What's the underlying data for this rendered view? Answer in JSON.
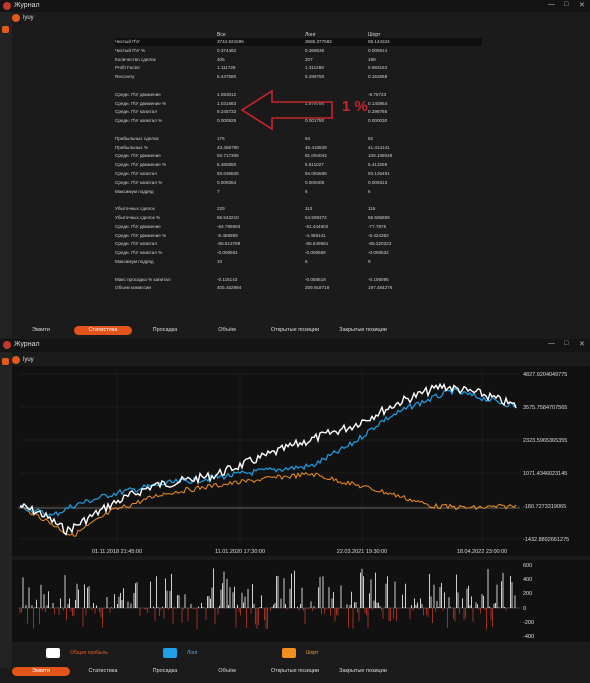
{
  "app": {
    "window_title": "Журнал",
    "close_glyph": "✕",
    "minimize_glyph": "—",
    "maximize_glyph": "□",
    "tab_label": "lyuy"
  },
  "stats": {
    "columns": [
      "Все",
      "Лонг",
      "Шорт"
    ],
    "rows": [
      {
        "label": "Чистый П\\У",
        "values": [
          "3744.521596",
          "3685.377582",
          "59.144324"
        ],
        "highlight": true
      },
      {
        "label": "Чистый П\\У %",
        "values": [
          "0.374482",
          "0.368536",
          "0.005914"
        ]
      },
      {
        "label": "Количество сделок",
        "values": [
          "405",
          "207",
          "198"
        ]
      },
      {
        "label": "Profit Factor",
        "values": [
          "1.111729",
          "1.311289",
          "0.983163"
        ]
      },
      {
        "label": "Recovery",
        "values": [
          "5.447580",
          "5.286760",
          "0.152868"
        ]
      },
      {
        "label": "",
        "values": [
          "",
          "",
          ""
        ]
      },
      {
        "label": "Средн. П\\У движение",
        "values": [
          "4.093012",
          "",
          "-8.76723"
        ]
      },
      {
        "label": "Средн. П\\У движение %",
        "values": [
          "1.031683",
          "1.979794",
          "0.140864"
        ]
      },
      {
        "label": "Средн. П\\У капитал",
        "values": [
          "9.245733",
          "",
          "0.298765"
        ]
      },
      {
        "label": "Средн. П\\У капитал %",
        "values": [
          "0.000925",
          "0.001780",
          "0.000030"
        ]
      },
      {
        "label": "",
        "values": [
          "",
          "",
          ""
        ]
      },
      {
        "label": "Прибыльных сделок",
        "values": [
          "176",
          "94",
          "82"
        ]
      },
      {
        "label": "Прибыльных %",
        "values": [
          "43.456790",
          "45.410628",
          "41.414141"
        ]
      },
      {
        "label": "Средн. П\\У движение",
        "values": [
          "93.717306",
          "81.094043",
          "108.108049"
        ]
      },
      {
        "label": "Средн. П\\У движение %",
        "values": [
          "5.465850",
          "5.511027",
          "5.413259"
        ]
      },
      {
        "label": "Средн. П\\У капитал",
        "values": [
          "93.636826",
          "94.082689",
          "93.125491"
        ]
      },
      {
        "label": "Средн. П\\У капитал %",
        "values": [
          "0.009364",
          "0.009408",
          "0.009313"
        ]
      },
      {
        "label": "Максимум подряд",
        "values": [
          "7",
          "6",
          "6"
        ]
      },
      {
        "label": "",
        "values": [
          "",
          "",
          ""
        ]
      },
      {
        "label": "Убыточных сделок",
        "values": [
          "229",
          "113",
          "116"
        ]
      },
      {
        "label": "Убыточных сделок %",
        "values": [
          "56.543210",
          "54.589372",
          "58.585859"
        ]
      },
      {
        "label": "Средн. П\\У движение",
        "values": [
          "-64.789693",
          "-51.444602",
          "-77.7875"
        ]
      },
      {
        "label": "Средн. П\\У движение %",
        "values": [
          "-5.458959",
          "-4.469141",
          "-6.424362"
        ]
      },
      {
        "label": "Средн. П\\У капитал",
        "values": [
          "-65.613789",
          "-65.649681",
          "-65.320223"
        ]
      },
      {
        "label": "Средн. П\\У капитал %",
        "values": [
          "-0.006561",
          "-0.006568",
          "-0.006532"
        ]
      },
      {
        "label": "Максимум подряд",
        "values": [
          "10",
          "6",
          "9"
        ]
      },
      {
        "label": "",
        "values": [
          "",
          "",
          ""
        ]
      },
      {
        "label": "Макс просадка % капитал",
        "values": [
          "-0.115143",
          "-0.058619",
          "-0.106095"
        ]
      },
      {
        "label": "Объем комиссии",
        "values": [
          "405.452994",
          "209.918718",
          "197.484276"
        ]
      }
    ]
  },
  "annotation": {
    "text": "1 %",
    "color": "#c8252b"
  },
  "tabs_top": [
    "Эквити",
    "Статистика",
    "Просадка",
    "Объём",
    "Открытые позиции",
    "Закрытые позиции"
  ],
  "tabs_top_active": 1,
  "tabs_bottom": [
    "Эквити",
    "Статистика",
    "Просадка",
    "Объём",
    "Открытые позиции",
    "Закрытые позиции"
  ],
  "tabs_bottom_active": 0,
  "chart": {
    "y_ticks": [
      "4827.9204049775",
      "3575.7584707565",
      "2323.5965365355",
      "1071.4346023145",
      "-180.7273319065",
      "-1432.8892661275"
    ],
    "x_ticks": [
      "01.11.2018 21:45:00",
      "11.01.2020 17:30:00",
      "22.03.2021 19:30:00",
      "18.04.2022 23:00:00"
    ],
    "vol_ticks": [
      "600",
      "400",
      "200",
      "0",
      "-200",
      "-400"
    ],
    "legend": [
      {
        "label": "Общая прибыль",
        "color": "#ffffff"
      },
      {
        "label": "Лонг",
        "color": "#1ea0e6"
      },
      {
        "label": "Шорт",
        "color": "#f0901e"
      }
    ]
  },
  "colors": {
    "accent": "#e2541a",
    "total": "#ffffff",
    "long": "#1ea0e6",
    "short": "#f0901e",
    "vol_pos": "#ffffff",
    "vol_neg": "#c0392b"
  }
}
